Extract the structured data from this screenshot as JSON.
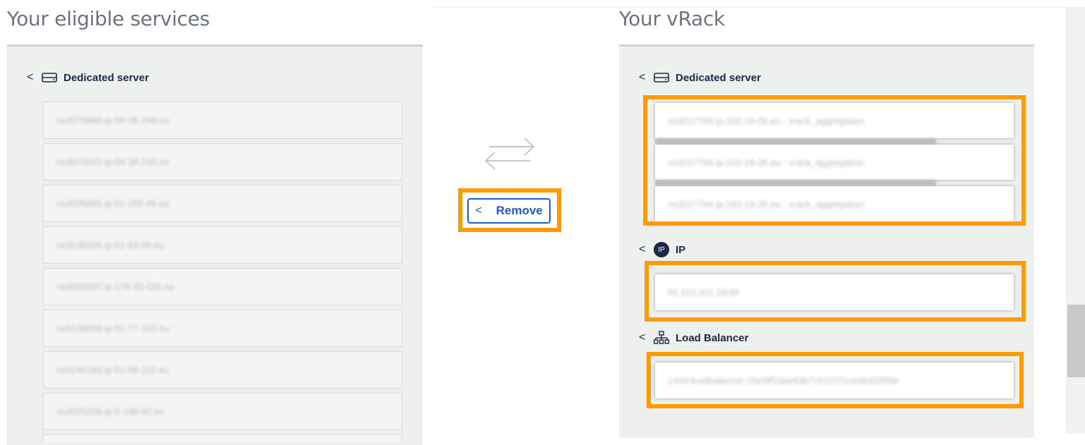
{
  "left": {
    "title": "Your eligible services",
    "group": {
      "label": "Dedicated server"
    },
    "items": [
      "ns3070868.ip-54-38-246.eu",
      "ns3070022.ip-54-38-245.eu",
      "ns3026265.ip-51-255-48.eu",
      "ns3136334.ip-51-83-96.eu",
      "ns3065097.ip-178-33-226.eu",
      "ns6136059.ip-51-77-102.eu",
      "ns3145182.ip-51-68-115.eu",
      "ns3025226.ip-5-196-92.eu"
    ]
  },
  "transfer": {
    "remove_label": "Remove"
  },
  "right": {
    "title": "Your vRack",
    "groups": [
      {
        "label": "Dedicated server",
        "items": [
          "ns3217793.ip-162-19-26.eu - vrack_aggregation",
          "ns3217796.ip-162-19-26.eu - vrack_aggregation",
          "ns3217794.ip-162-19-26.eu - vrack_aggregation"
        ]
      },
      {
        "label": "IP",
        "icon_text": "IP",
        "items": [
          "51.210.201.28/30"
        ]
      },
      {
        "label": "Load Balancer",
        "items": [
          "1444-loadbalancer-1fa09f53ae63b7c010721ce9bd1f9f9e"
        ]
      }
    ]
  },
  "colors": {
    "highlight": "#ff9a00",
    "accent": "#1d5bc4",
    "panel": "#eef0ee",
    "heading": "#6b7480"
  },
  "icons": [
    "chevron-left-icon",
    "server-icon",
    "ip-icon",
    "load-balancer-icon",
    "transfer-arrows-icon"
  ]
}
